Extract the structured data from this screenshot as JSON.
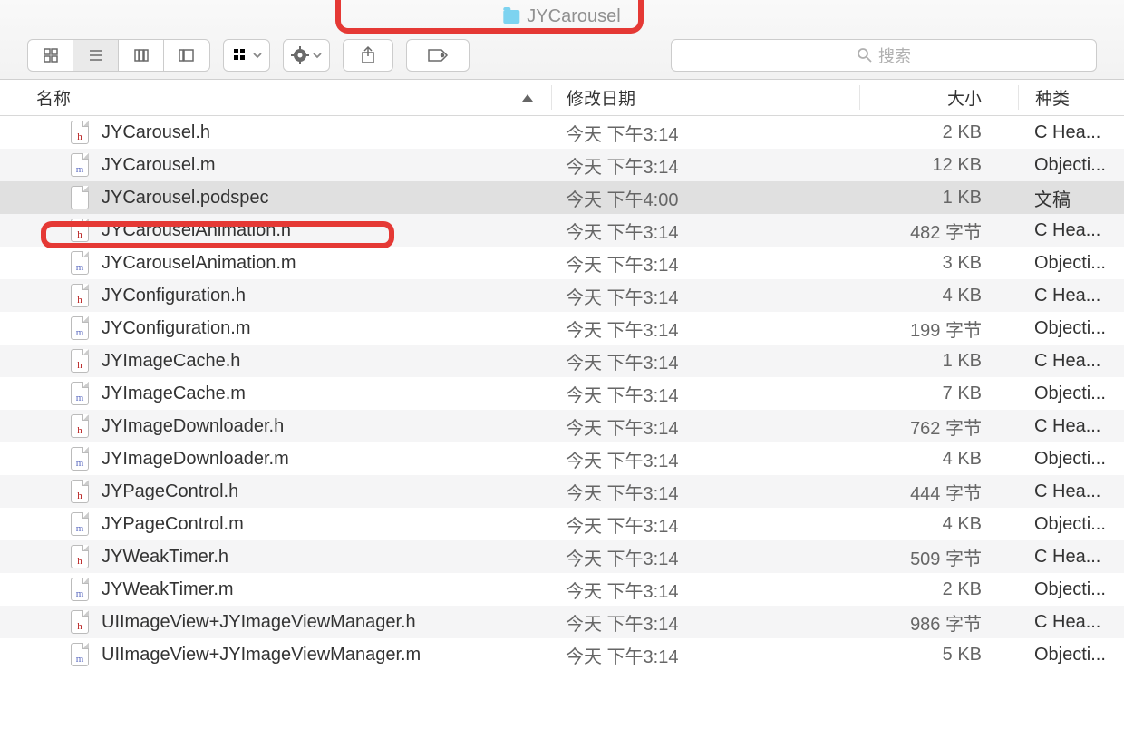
{
  "window": {
    "title": "JYCarousel"
  },
  "search": {
    "placeholder": "搜索"
  },
  "columns": {
    "name": "名称",
    "date": "修改日期",
    "size": "大小",
    "kind": "种类"
  },
  "files": [
    {
      "name": "JYCarousel.h",
      "icon": "h",
      "date": "今天 下午3:14",
      "size": "2 KB",
      "kind": "C Hea..."
    },
    {
      "name": "JYCarousel.m",
      "icon": "m",
      "date": "今天 下午3:14",
      "size": "12 KB",
      "kind": "Objecti..."
    },
    {
      "name": "JYCarousel.podspec",
      "icon": "blank",
      "date": "今天 下午4:00",
      "size": "1 KB",
      "kind": "文稿",
      "selected": true
    },
    {
      "name": "JYCarouselAnimation.h",
      "icon": "h",
      "date": "今天 下午3:14",
      "size": "482 字节",
      "kind": "C Hea..."
    },
    {
      "name": "JYCarouselAnimation.m",
      "icon": "m",
      "date": "今天 下午3:14",
      "size": "3 KB",
      "kind": "Objecti..."
    },
    {
      "name": "JYConfiguration.h",
      "icon": "h",
      "date": "今天 下午3:14",
      "size": "4 KB",
      "kind": "C Hea..."
    },
    {
      "name": "JYConfiguration.m",
      "icon": "m",
      "date": "今天 下午3:14",
      "size": "199 字节",
      "kind": "Objecti..."
    },
    {
      "name": "JYImageCache.h",
      "icon": "h",
      "date": "今天 下午3:14",
      "size": "1 KB",
      "kind": "C Hea..."
    },
    {
      "name": "JYImageCache.m",
      "icon": "m",
      "date": "今天 下午3:14",
      "size": "7 KB",
      "kind": "Objecti..."
    },
    {
      "name": "JYImageDownloader.h",
      "icon": "h",
      "date": "今天 下午3:14",
      "size": "762 字节",
      "kind": "C Hea..."
    },
    {
      "name": "JYImageDownloader.m",
      "icon": "m",
      "date": "今天 下午3:14",
      "size": "4 KB",
      "kind": "Objecti..."
    },
    {
      "name": "JYPageControl.h",
      "icon": "h",
      "date": "今天 下午3:14",
      "size": "444 字节",
      "kind": "C Hea..."
    },
    {
      "name": "JYPageControl.m",
      "icon": "m",
      "date": "今天 下午3:14",
      "size": "4 KB",
      "kind": "Objecti..."
    },
    {
      "name": "JYWeakTimer.h",
      "icon": "h",
      "date": "今天 下午3:14",
      "size": "509 字节",
      "kind": "C Hea..."
    },
    {
      "name": "JYWeakTimer.m",
      "icon": "m",
      "date": "今天 下午3:14",
      "size": "2 KB",
      "kind": "Objecti..."
    },
    {
      "name": "UIImageView+JYImageViewManager.h",
      "icon": "h",
      "date": "今天 下午3:14",
      "size": "986 字节",
      "kind": "C Hea..."
    },
    {
      "name": "UIImageView+JYImageViewManager.m",
      "icon": "m",
      "date": "今天 下午3:14",
      "size": "5 KB",
      "kind": "Objecti..."
    }
  ]
}
